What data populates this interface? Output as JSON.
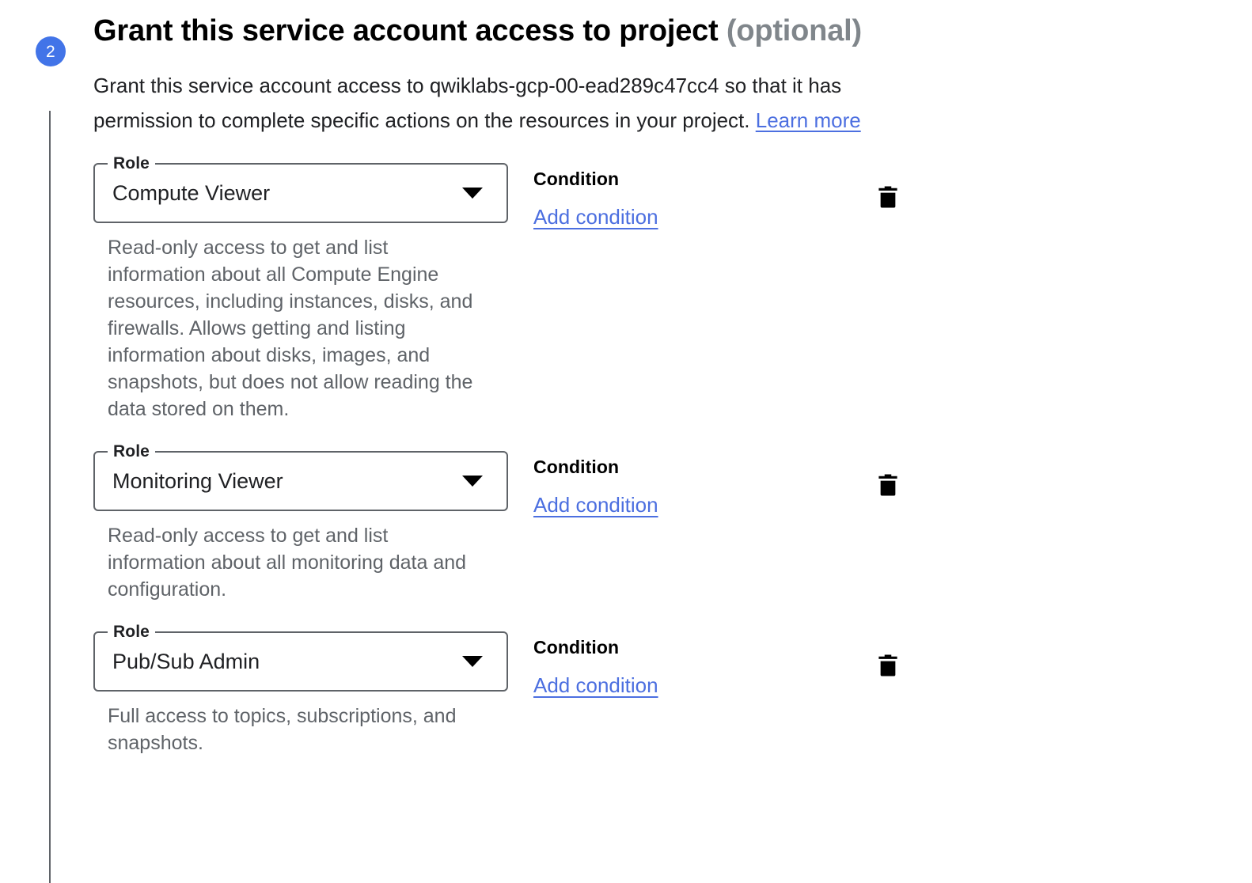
{
  "step": {
    "number": "2",
    "title_main": "Grant this service account access to project",
    "title_optional": "(optional)",
    "description_before_link": "Grant this service account access to qwiklabs-gcp-00-ead289c47cc4 so that it has permission to complete specific actions on the resources in your project. ",
    "learn_more_label": "Learn more",
    "project_id": "qwiklabs-gcp-00-ead289c47cc4"
  },
  "labels": {
    "role_label": "Role",
    "condition_label": "Condition",
    "add_condition_label": "Add condition",
    "delete_icon": "trash-icon",
    "dropdown_icon": "chevron-down-icon"
  },
  "colors": {
    "accent_blue": "#4274e8",
    "link_blue": "#4c6fe0",
    "muted_grey": "#5f6368",
    "optional_grey": "#80868b"
  },
  "roles": [
    {
      "label": "Role",
      "value": "Compute Viewer",
      "description": "Read-only access to get and list information about all Compute Engine resources, including instances, disks, and firewalls. Allows getting and listing information about disks, images, and snapshots, but does not allow reading the data stored on them.",
      "condition_title": "Condition",
      "condition_link": "Add condition"
    },
    {
      "label": "Role",
      "value": "Monitoring Viewer",
      "description": "Read-only access to get and list information about all monitoring data and configuration.",
      "condition_title": "Condition",
      "condition_link": "Add condition"
    },
    {
      "label": "Role",
      "value": "Pub/Sub Admin",
      "description": "Full access to topics, subscriptions, and snapshots.",
      "condition_title": "Condition",
      "condition_link": "Add condition"
    }
  ]
}
